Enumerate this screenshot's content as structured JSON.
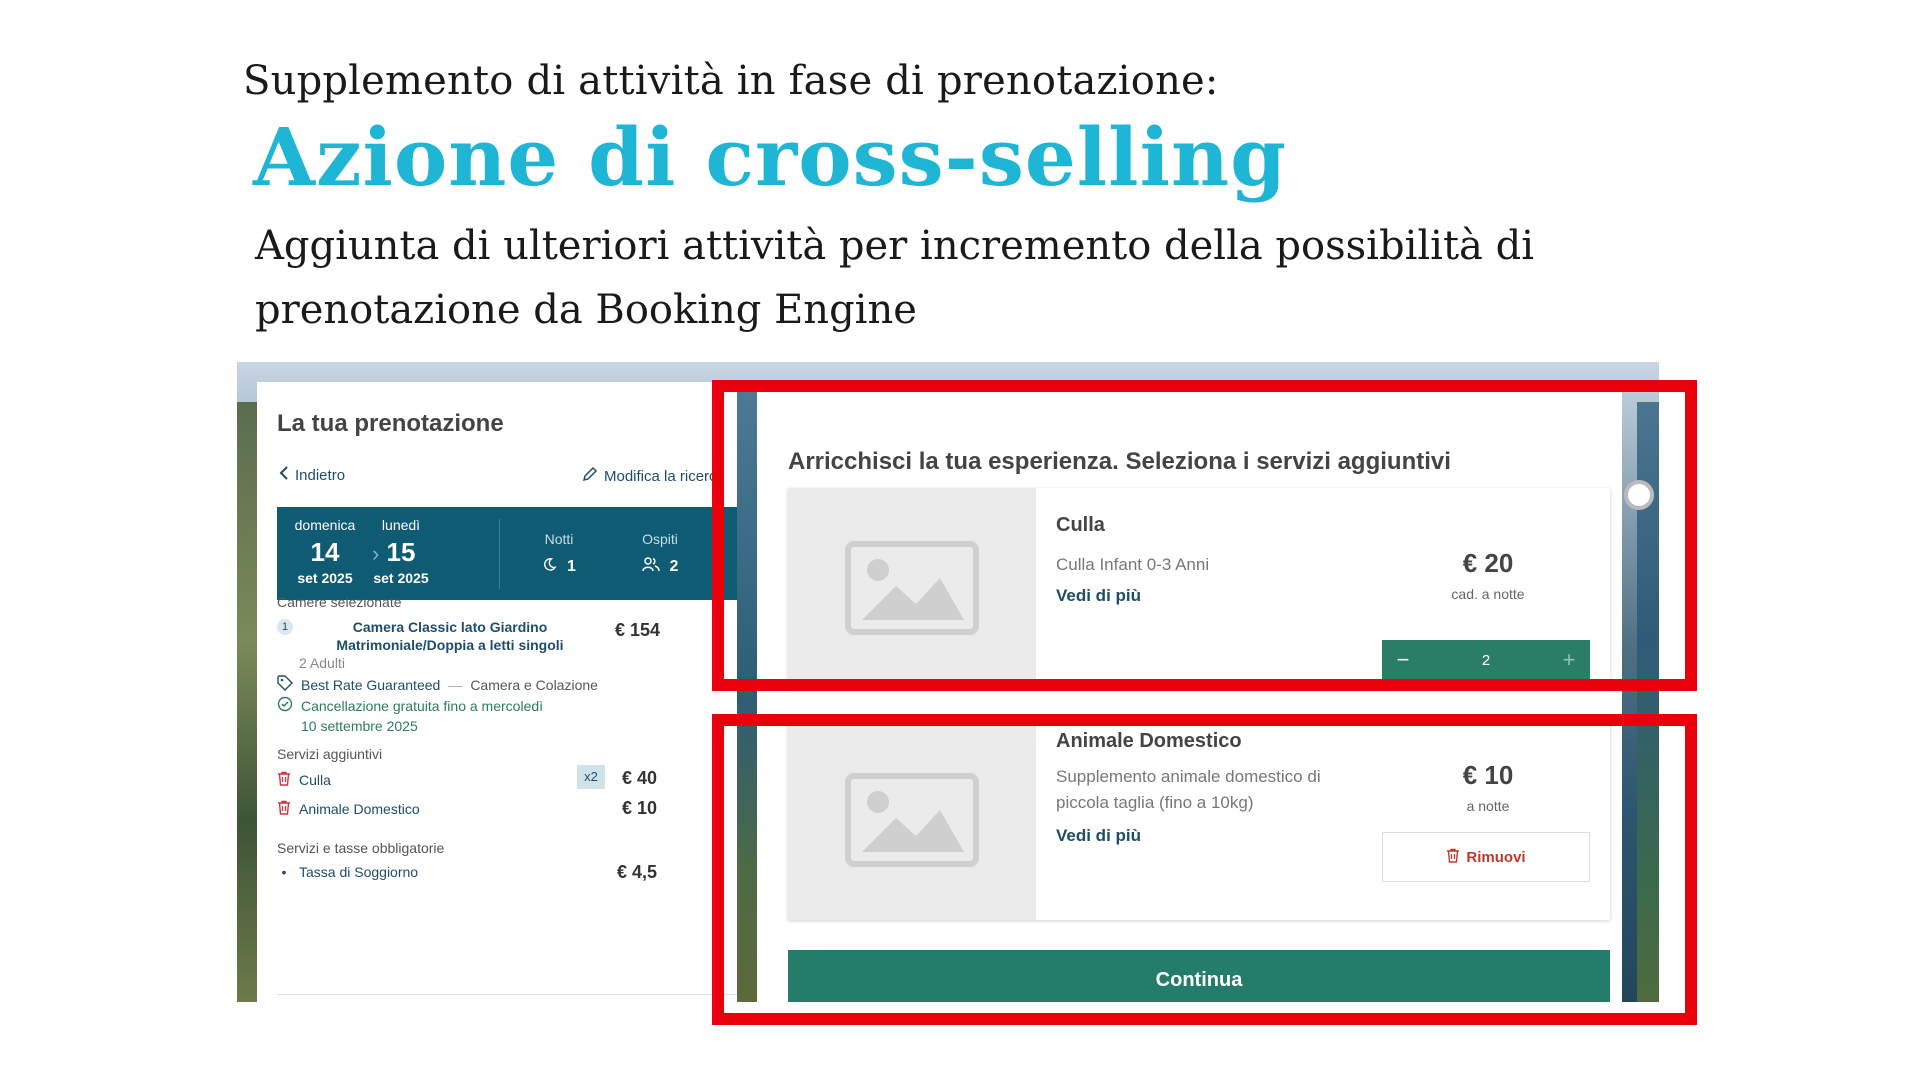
{
  "slide": {
    "intro": "Supplemento di attività in fase di prenotazione:",
    "title": "Azione di cross-selling",
    "description": "Aggiunta di ulteriori attività per incremento della possibilità di prenotazione da Booking Engine"
  },
  "booking": {
    "title": "La tua prenotazione",
    "back_label": "Indietro",
    "edit_label": "Modifica la ricerc",
    "checkin": {
      "weekday": "domenica",
      "day": "14",
      "month": "set 2025"
    },
    "checkout": {
      "weekday": "lunedì",
      "day": "15",
      "month": "set 2025"
    },
    "nights_label": "Notti",
    "nights_value": "1",
    "guests_label": "Ospiti",
    "guests_value": "2",
    "rooms_label": "Camere selezionate",
    "room": {
      "number": "1",
      "name": "Camera Classic lato Giardino Matrimoniale/Doppia a letti singoli",
      "price": "€ 154",
      "occupancy": "2 Adulti",
      "rate": "Best Rate Guaranteed",
      "rate_separator": "—",
      "board": "Camera e Colazione",
      "cancellation": "Cancellazione gratuita fino a mercoledì 10 settembre 2025"
    },
    "services_label": "Servizi aggiuntivi",
    "services": [
      {
        "name": "Culla",
        "qty": "x2",
        "price": "€ 40"
      },
      {
        "name": "Animale Domestico",
        "price": "€ 10"
      }
    ],
    "taxes_label": "Servizi e tasse obbligatorie",
    "tax": {
      "bullet": "•",
      "name": "Tassa di Soggiorno",
      "price": "€ 4,5"
    }
  },
  "extras": {
    "title": "Arricchisci la tua esperienza. Seleziona i servizi aggiuntivi",
    "cards": [
      {
        "name": "Culla",
        "description": "Culla Infant 0-3 Anni",
        "more_label": "Vedi di più",
        "price": "€ 20",
        "unit": "cad. a notte",
        "quantity": "2",
        "minus": "−",
        "plus": "+"
      },
      {
        "name": "Animale Domestico",
        "description": "Supplemento animale domestico di piccola taglia (fino a 10kg)",
        "more_label": "Vedi di più",
        "price": "€ 10",
        "unit": "a notte",
        "remove_label": "Rimuovi"
      }
    ],
    "continue_label": "Continua"
  },
  "colors": {
    "title_accent": "#1fb6d6",
    "highlight": "#e8000b",
    "primary_green": "#237d6a",
    "date_box": "#0f5b74"
  },
  "icons": [
    "chevron-left-icon",
    "pencil-icon",
    "moon-icon",
    "guests-icon",
    "tag-icon",
    "check-circle-icon",
    "trash-icon",
    "image-placeholder-icon",
    "loading-spinner-icon"
  ]
}
